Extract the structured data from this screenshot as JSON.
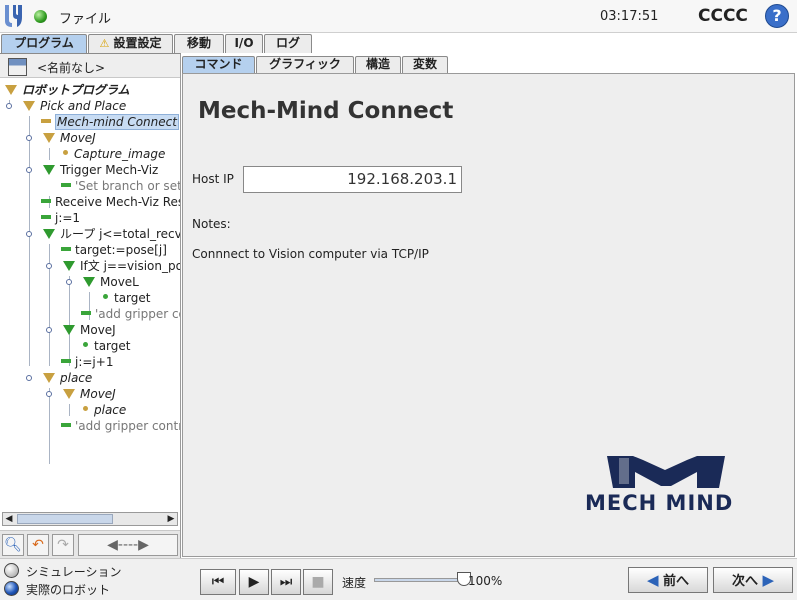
{
  "topbar": {
    "file_label": "ファイル",
    "clock": "03:17:51",
    "robot_name": "CCCC",
    "help_symbol": "?"
  },
  "main_tabs": [
    {
      "label": "プログラム",
      "active": true
    },
    {
      "label": "設置設定",
      "warning": true
    },
    {
      "label": "移動"
    },
    {
      "label": "I/O"
    },
    {
      "label": "ログ"
    }
  ],
  "program": {
    "name": "<名前なし>"
  },
  "tree": {
    "root": "ロボットプログラム",
    "rows": [
      {
        "label": "Pick and Place"
      },
      {
        "label": "Mech-mind Connect"
      },
      {
        "label": "MoveJ"
      },
      {
        "label": "Capture_image"
      },
      {
        "label": "Trigger Mech-Viz"
      },
      {
        "label": "'Set branch or set i"
      },
      {
        "label": "Receive Mech-Viz Res"
      },
      {
        "label": "j:=1"
      },
      {
        "label": "ループ j<=total_recv"
      },
      {
        "label": "target:=pose[j]"
      },
      {
        "label": "If文 j==vision_poi"
      },
      {
        "label": "MoveL"
      },
      {
        "label": "target"
      },
      {
        "label": "'add gripper co"
      },
      {
        "label": "MoveJ"
      },
      {
        "label": "target"
      },
      {
        "label": "j:=j+1"
      },
      {
        "label": "place"
      },
      {
        "label": "MoveJ"
      },
      {
        "label": "place"
      },
      {
        "label": "'add gripper contro"
      }
    ]
  },
  "sub_tabs": [
    {
      "label": "コマンド",
      "active": true
    },
    {
      "label": "グラフィック"
    },
    {
      "label": "構造"
    },
    {
      "label": "変数"
    }
  ],
  "node": {
    "title": "Mech-Mind Connect",
    "host_label": "Host IP",
    "host_value": "192.168.203.1",
    "notes_label": "Notes:",
    "notes_text": "Connnect to Vision computer via TCP/IP",
    "logo_text": "MECH MIND"
  },
  "bottom": {
    "sim_label": "シミュレーション",
    "real_label": "実際のロボット",
    "speed_label": "速度",
    "speed_value": "100%",
    "speed_fraction": 1.0,
    "prev_label": "前へ",
    "next_label": "次へ"
  },
  "colors": {
    "tab_active": "#b5d0ee",
    "node_green": "#2f9a2f",
    "node_gold": "#c8a040",
    "brand": "#1a2a57",
    "arrow_blue": "#2c63b8"
  }
}
